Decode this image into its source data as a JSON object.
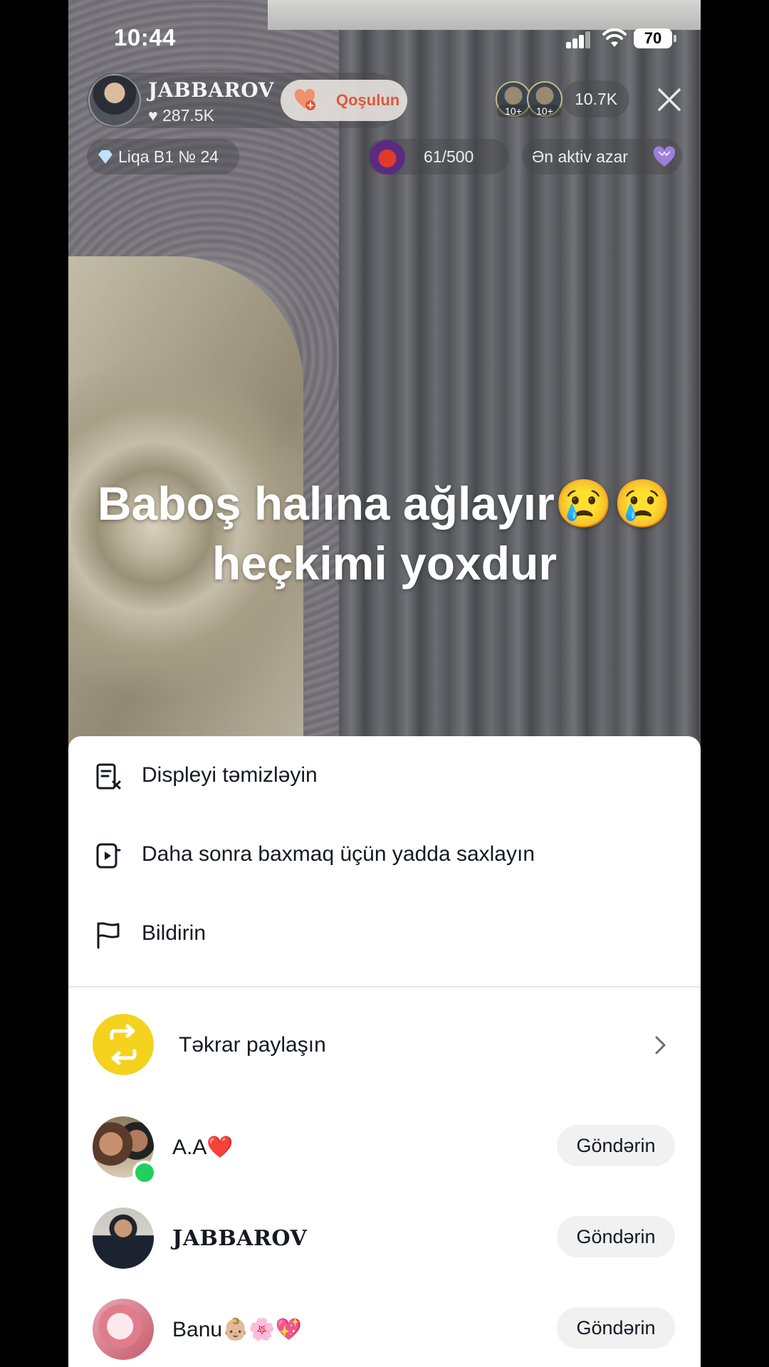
{
  "status_bar": {
    "time": "10:44",
    "battery": "70"
  },
  "live": {
    "host_name": "JABBAROV",
    "host_likes": "287.5K",
    "join_label": "Qoşulun",
    "viewer_badges": [
      "10+",
      "10+"
    ],
    "viewer_count": "10.7K",
    "league": "Liqa B1 № 24",
    "goal_progress": "61/500",
    "active_label": "Ən aktiv azar",
    "caption_line1": "Baboş halına ağlayır😢😢",
    "caption_line2": "heçkimi yoxdur"
  },
  "sheet": {
    "menu": [
      {
        "label": "Displeyi təmizləyin",
        "icon": "clear-display-icon"
      },
      {
        "label": "Daha sonra baxmaq üçün yadda saxlayın",
        "icon": "watch-later-icon"
      },
      {
        "label": "Bildirin",
        "icon": "flag-icon"
      }
    ],
    "repost_label": "Təkrar paylaşın",
    "contacts": [
      {
        "name": "A.A❤️",
        "send": "Göndərin",
        "online": true
      },
      {
        "name": "JABBAROV",
        "send": "Göndərin",
        "online": false
      },
      {
        "name": "Banu👶🏼🌸💖",
        "send": "Göndərin",
        "online": false
      }
    ]
  },
  "colors": {
    "accent_yellow": "#f5d21d",
    "online_green": "#21d05c",
    "join_text": "#e0573a"
  }
}
